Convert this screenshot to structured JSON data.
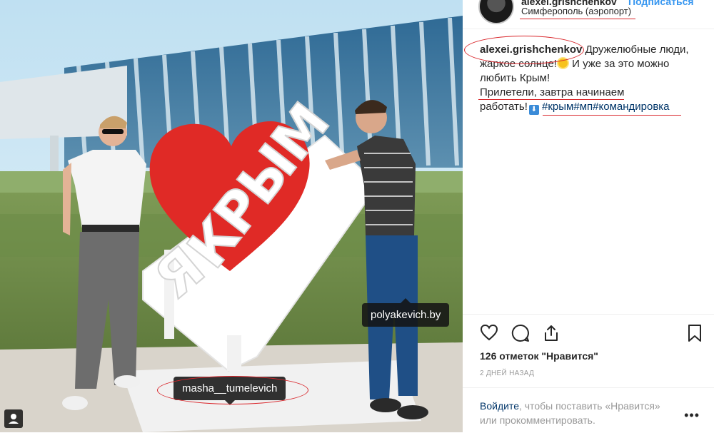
{
  "post": {
    "header": {
      "username": "alexei.grishchenkov",
      "follow_label": "Подписаться",
      "location": "Симферополь (аэропорт)"
    },
    "caption": {
      "author": "alexei.grishchenkov",
      "line1": "Дружелюбные люди,",
      "line2": "жаркое солнце!",
      "line2b": "И уже за это можно",
      "line3": "любить Крым!",
      "line4": "Прилетели, завтра начинаем",
      "line5": "работать!",
      "hashtags": "#крым#мп#командировка"
    },
    "likes": "126 отметок \"Нравится\"",
    "time": "2 ДНЕЙ НАЗАД",
    "login": {
      "link": "Войдите",
      "text_a": ", чтобы поставить «Нравится»",
      "text_b": "или прокомментировать."
    },
    "more_label": "•••"
  },
  "photo": {
    "tags": {
      "right": "polyakevich.by",
      "bottom": "masha__tumelevich"
    },
    "sign": {
      "ya": "Я",
      "krym": "КРЫМ"
    }
  },
  "icons": [
    "heart-icon",
    "comment-icon",
    "share-icon",
    "bookmark-icon",
    "user-tag-icon"
  ],
  "colors": {
    "annotation_red": "#d9262b",
    "link_blue": "#003569",
    "follow_blue": "#3897f0",
    "heart_red": "#e02a26"
  }
}
